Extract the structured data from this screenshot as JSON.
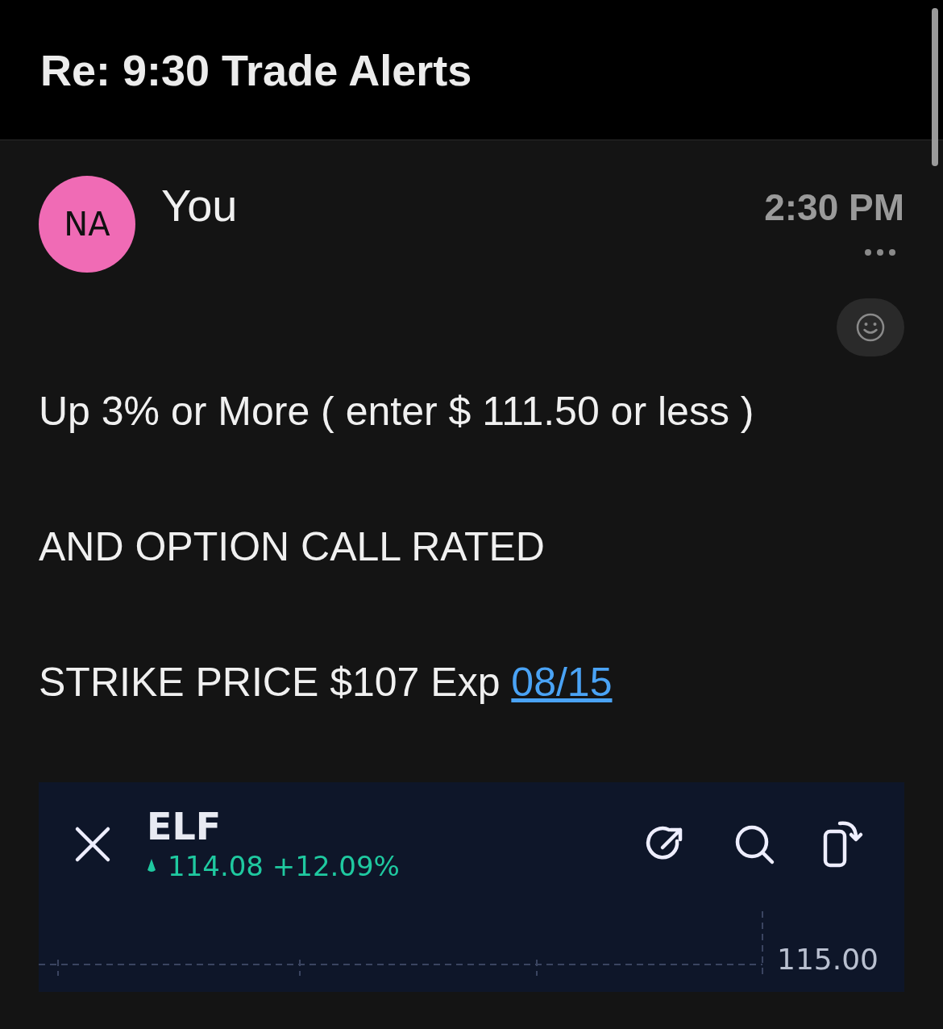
{
  "header": {
    "title": "Re: 9:30 Trade Alerts"
  },
  "message": {
    "avatar_initials": "NA",
    "sender": "You",
    "time": "2:30 PM",
    "lines": [
      {
        "text": "Up 3% or More ( enter $ 111.50 or less )"
      },
      {
        "text": "AND OPTION CALL RATED"
      },
      {
        "text": "STRIKE PRICE $107 Exp",
        "link": "08/15"
      }
    ]
  },
  "attachment": {
    "symbol": "ELF",
    "price": "114.08",
    "change": "+12.09%",
    "price_label": "115.00"
  }
}
